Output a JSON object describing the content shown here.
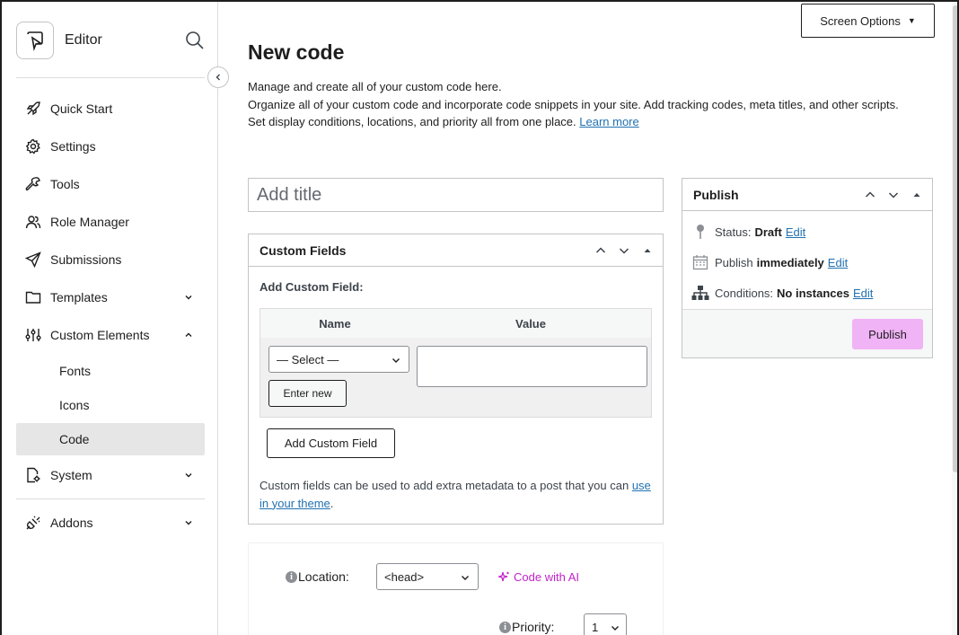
{
  "sidebar": {
    "brand_title": "Editor",
    "items": [
      {
        "label": "Quick Start",
        "icon": "rocket-icon"
      },
      {
        "label": "Settings",
        "icon": "gear-icon"
      },
      {
        "label": "Tools",
        "icon": "wrench-icon"
      },
      {
        "label": "Role Manager",
        "icon": "users-icon"
      },
      {
        "label": "Submissions",
        "icon": "paper-plane-icon"
      },
      {
        "label": "Templates",
        "icon": "folder-icon"
      },
      {
        "label": "Custom Elements",
        "icon": "sliders-icon"
      },
      {
        "label": "System",
        "icon": "system-doc-icon"
      },
      {
        "label": "Addons",
        "icon": "plug-icon"
      }
    ],
    "sub_items": [
      "Fonts",
      "Icons",
      "Code"
    ],
    "active_sub": "Code"
  },
  "header": {
    "screen_options": "Screen Options",
    "page_title": "New code",
    "intro_line1": "Manage and create all of your custom code here.",
    "intro_line2": "Organize all of your custom code and incorporate code snippets in your site. Add tracking codes, meta titles, and other scripts. Set display conditions, locations, and priority all from one place.",
    "learn_more": "Learn more"
  },
  "title_field": {
    "placeholder": "Add title",
    "value": ""
  },
  "custom_fields": {
    "title": "Custom Fields",
    "add_label": "Add Custom Field:",
    "col_name": "Name",
    "col_value": "Value",
    "select_value": "— Select —",
    "enter_new": "Enter new",
    "add_button": "Add Custom Field",
    "note": "Custom fields can be used to add extra metadata to a post that you can ",
    "note_link": "use in your theme",
    "note_end": "."
  },
  "publish": {
    "title": "Publish",
    "status_label": "Status:",
    "status_value": "Draft",
    "publish_label": "Publish",
    "publish_value": "immediately",
    "conditions_label": "Conditions:",
    "conditions_value": "No instances",
    "edit": "Edit",
    "button": "Publish"
  },
  "code_settings": {
    "location_label": "Location:",
    "location_value": "<head>",
    "ai_link": "Code with AI",
    "priority_label": "Priority:",
    "priority_value": "1",
    "info_glyph": "i"
  },
  "colors": {
    "accent_link": "#2271b1",
    "publish_button": "#f0b3f5",
    "ai_accent": "#c024c9",
    "active_bg": "#e6e6e6"
  }
}
